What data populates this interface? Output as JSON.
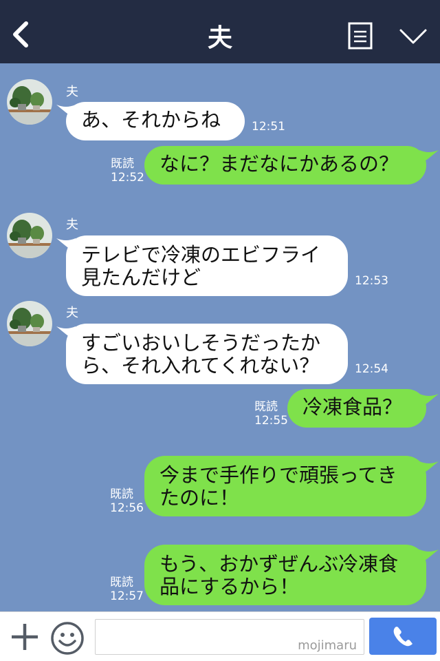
{
  "header": {
    "title": "夫"
  },
  "sender_name": "夫",
  "messages": [
    {
      "dir": "in",
      "text": "あ、それからね",
      "time": "12:51"
    },
    {
      "dir": "out",
      "text": "なに？まだなにかあるの？",
      "read": "既読",
      "time": "12:52"
    },
    {
      "dir": "in",
      "text": "テレビで冷凍のエビフライ\n見たんだけど",
      "time": "12:53"
    },
    {
      "dir": "in",
      "text": "すごいおいしそうだったか\nら、それ入れてくれない？",
      "time": "12:54"
    },
    {
      "dir": "out",
      "text": "冷凍食品？",
      "read": "既読",
      "time": "12:55"
    },
    {
      "dir": "out",
      "text": "今まで手作りで頑張ってき\nたのに！",
      "read": "既読",
      "time": "12:56"
    },
    {
      "dir": "out",
      "text": "もう、おかずぜんぶ冷凍食\n品にするから！",
      "read": "既読",
      "time": "12:57"
    }
  ],
  "footer": {
    "watermark": "mojimaru"
  },
  "colors": {
    "header_bg": "#232c43",
    "chat_bg": "#7393c3",
    "outgoing_bubble": "#7fe14b",
    "incoming_bubble": "#ffffff",
    "call_button": "#4a82e8"
  }
}
